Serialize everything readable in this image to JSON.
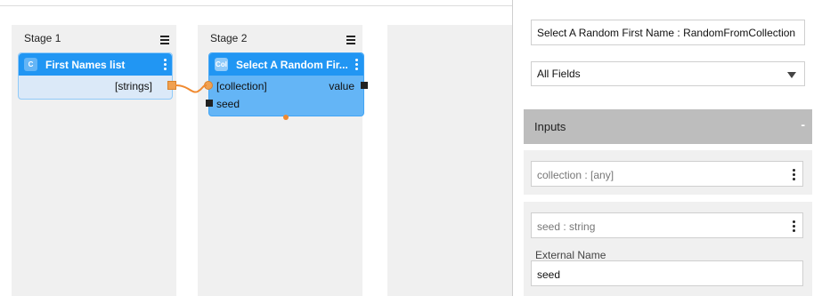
{
  "canvas": {
    "stages": [
      {
        "title": "Stage 1"
      },
      {
        "title": "Stage 2"
      }
    ],
    "nodes": [
      {
        "badge": "C",
        "title": "First Names list",
        "outputs": [
          "[strings]"
        ]
      },
      {
        "badge": "Col",
        "title": "Select A Random Fir...",
        "inputs": [
          "[collection]",
          "seed"
        ],
        "outputs": [
          "value"
        ]
      }
    ],
    "connections": [
      {
        "from": "First Names list.[strings]",
        "to": "Select A Random Fir....[collection]"
      }
    ]
  },
  "panel": {
    "name_value": "Select A Random First Name : RandomFromCollection",
    "fields_select": "All Fields",
    "inputs_section": {
      "title": "Inputs",
      "collapse_symbol": "-",
      "items": [
        {
          "label": "collection : [any]"
        },
        {
          "label": "seed : string",
          "external_name_label": "External Name",
          "external_name_value": "seed"
        }
      ]
    }
  },
  "colors": {
    "node_header": "#2196f3",
    "node_body_selected": "#64b5f6",
    "node_body": "#dbe9f8",
    "connector": "#f08a30",
    "stage_bg": "#f0f0f0",
    "inputs_header_bg": "#bdbdbd"
  },
  "icons": [
    "hamburger-menu-icon",
    "kebab-menu-icon",
    "dropdown-arrow-icon",
    "collapse-icon"
  ]
}
